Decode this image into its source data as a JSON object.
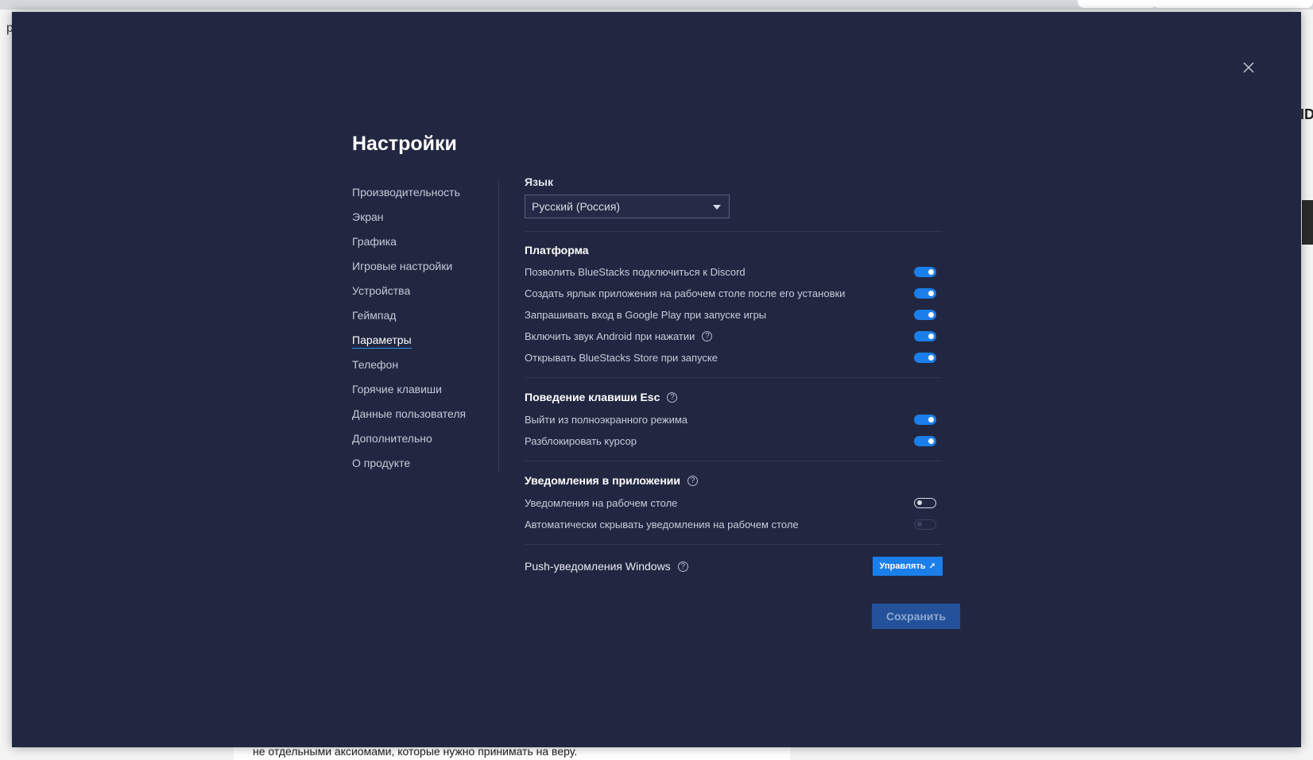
{
  "background": {
    "left_letter": "р",
    "right_text": "ID",
    "bottom_text": "не отдельными аксиомами, которые нужно принимать на веру."
  },
  "modal": {
    "title": "Настройки",
    "close_icon": "close-icon"
  },
  "nav": {
    "items": [
      {
        "label": "Производительность",
        "active": false
      },
      {
        "label": "Экран",
        "active": false
      },
      {
        "label": "Графика",
        "active": false
      },
      {
        "label": "Игровые настройки",
        "active": false
      },
      {
        "label": "Устройства",
        "active": false
      },
      {
        "label": "Геймпад",
        "active": false
      },
      {
        "label": "Параметры",
        "active": true
      },
      {
        "label": "Телефон",
        "active": false
      },
      {
        "label": "Горячие клавиши",
        "active": false
      },
      {
        "label": "Данные пользователя",
        "active": false
      },
      {
        "label": "Дополнительно",
        "active": false
      },
      {
        "label": "О продукте",
        "active": false
      }
    ]
  },
  "language": {
    "label": "Язык",
    "selected": "Русский (Россия)"
  },
  "platform": {
    "title": "Платформа",
    "items": [
      {
        "label": "Позволить BlueStacks подключиться к Discord",
        "state": "on"
      },
      {
        "label": "Создать ярлык приложения на рабочем столе после его установки",
        "state": "on"
      },
      {
        "label": "Запрашивать вход в Google Play при запуске игры",
        "state": "on"
      },
      {
        "label": "Включить звук Android при нажатии",
        "state": "on"
      },
      {
        "label": "Открывать BlueStacks Store при запуске",
        "state": "on"
      }
    ]
  },
  "esc": {
    "title": "Поведение клавиши Esc",
    "items": [
      {
        "label": "Выйти из полноэкранного режима",
        "state": "on"
      },
      {
        "label": "Разблокировать курсор",
        "state": "on"
      }
    ]
  },
  "notifications": {
    "title": "Уведомления в приложении",
    "items": [
      {
        "label": "Уведомления на рабочем столе",
        "state": "off"
      },
      {
        "label": "Автоматически скрывать уведомления на рабочем столе",
        "state": "disabled"
      }
    ]
  },
  "push": {
    "title": "Push-уведомления Windows",
    "button_label": "Управлять",
    "button_icon": "external-link-icon"
  },
  "save_label": "Сохранить",
  "colors": {
    "modal_bg": "#222741",
    "accent": "#1a7fea",
    "save_bg": "#23529b"
  }
}
